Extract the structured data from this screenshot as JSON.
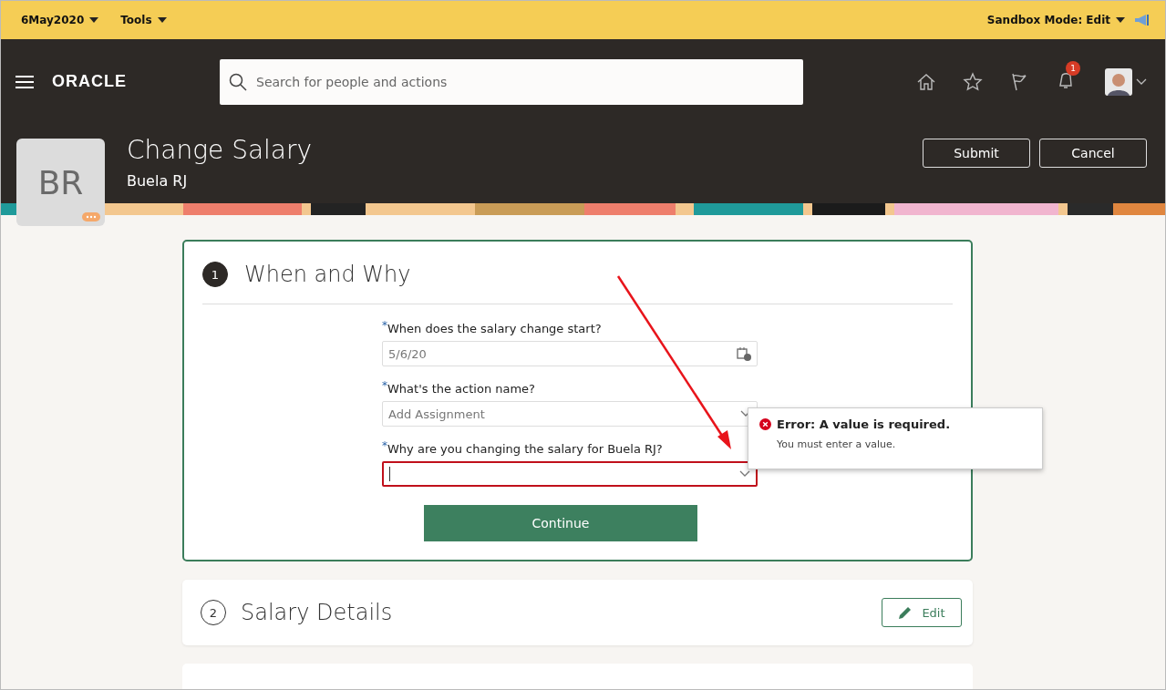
{
  "top_bar": {
    "date_menu": "6May2020",
    "tools_menu": "Tools",
    "sandbox_menu": "Sandbox Mode: Edit"
  },
  "nav": {
    "logo": "ORACLE",
    "search": {
      "placeholder": "Search for people and actions"
    },
    "notification_count": "1"
  },
  "page": {
    "initials": "BR",
    "title": "Change Salary",
    "subtitle": "Buela RJ",
    "buttons": [
      {
        "label": "Submit"
      },
      {
        "label": "Cancel"
      }
    ]
  },
  "steps": [
    {
      "number": "1",
      "title": "When and Why",
      "selected": true,
      "fields": [
        {
          "kind": "date",
          "label": "When does the salary change start?",
          "required": "*",
          "value": "5/6/20",
          "error": false
        },
        {
          "kind": "select",
          "label": "What's the action name?",
          "required": "*",
          "value": "Add Assignment",
          "error": false
        },
        {
          "kind": "select",
          "label": "Why are you changing the salary for Buela RJ?",
          "required": "*",
          "error": true
        }
      ],
      "error": {
        "title": "Error: A value is required.",
        "message": "You must enter a value."
      },
      "continue": "Continue"
    },
    {
      "number": "2",
      "title": "Salary Details",
      "selected": false,
      "edit": "Edit"
    }
  ]
}
